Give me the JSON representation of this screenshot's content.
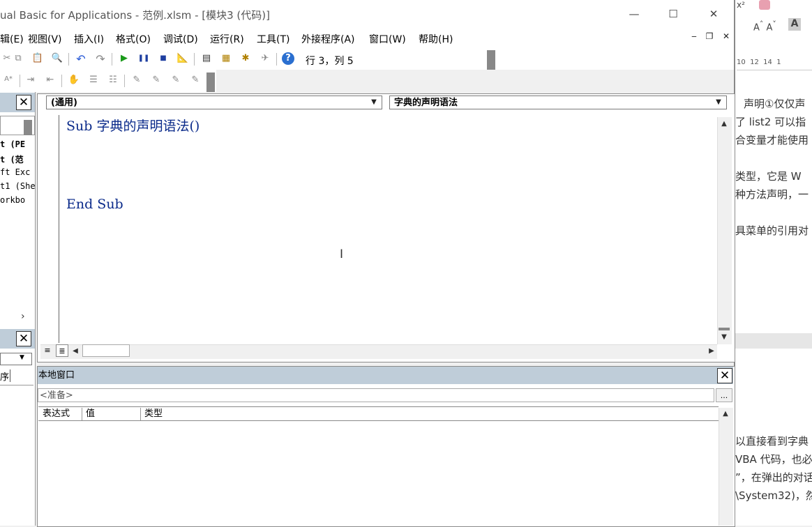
{
  "window": {
    "title": "ual Basic for Applications - 范例.xlsm - [模块3 (代码)]",
    "minimize": "—",
    "maximize": "☐",
    "close": "✕"
  },
  "menu": {
    "items": [
      "辑(E)",
      "视图(V)",
      "插入(I)",
      "格式(O)",
      "调试(D)",
      "运行(R)",
      "工具(T)",
      "外接程序(A)",
      "窗口(W)",
      "帮助(H)"
    ],
    "mdi_min": "‒",
    "mdi_restore": "❐",
    "mdi_close": "✕"
  },
  "toolbar": {
    "position": "行 3，列 5",
    "help_icon": "?"
  },
  "project_pane": {
    "tree": [
      "t (PE",
      "t (范",
      "ft Exc",
      "t1 (She",
      "orkbo"
    ],
    "close": "✕",
    "properties_close": "✕",
    "tab_label": "序"
  },
  "code_window": {
    "object_combo": "(通用)",
    "proc_combo": "字典的声明语法",
    "lines": [
      "Sub 字典的声明语法()",
      "",
      "",
      "End Sub"
    ]
  },
  "locals": {
    "title": "本地窗口",
    "context": "<准备>",
    "ellipsis": "...",
    "columns": [
      "表达式",
      "值",
      "类型"
    ],
    "close": "✕"
  },
  "doc_fragments": [
    "声明①仅仅声",
    "了 list2 可以指",
    "合变量才能使用",
    "类型，它是 W",
    "种方法声明，一",
    "具菜单的引用对",
    "以直接看到字典",
    "VBA 代码，也必",
    "”，在弹出的对话",
    "\\System32)，然"
  ],
  "ruler": "10  12  14  1"
}
